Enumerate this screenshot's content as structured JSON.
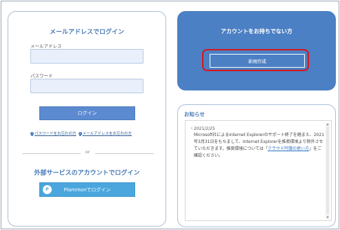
{
  "login": {
    "title": "メールアドレスでログイン",
    "email_label": "メールアドレス",
    "email_value": "",
    "password_label": "パスワード",
    "password_value": "",
    "login_button": "ログイン",
    "forgot_password": "パスワードをお忘れの方",
    "forgot_email": "メールアドレスをお忘れの方",
    "or_text": "or",
    "external_title": "外部サービスのアカウントでログイン",
    "external_button": "Plammonでログイン",
    "external_logo": "P"
  },
  "signup": {
    "title": "アカウントをお持ちでない方",
    "button": "新規作成"
  },
  "news": {
    "title": "お知らせ",
    "date": "・2021/2/25",
    "body_prefix": "Microsoft社によるInternet Explorerのサポート終了を踏まえ、2021年3月31日をもちまして、Internet Explorerを推奨環境より除外させていただきます。推奨環境については「",
    "link_text": "クラウド円簿の使い方",
    "body_suffix": "」をご確認ください。"
  },
  "colors": {
    "accent": "#4a7bb7",
    "signup_bg": "#4b80c4",
    "highlight": "#d7141a",
    "login_button": "#5b8ad0",
    "external_button": "#4aa6dd"
  },
  "icons": {
    "help": "question-circle-icon",
    "external_logo": "plammon-logo-icon",
    "scroll_up": "scroll-up-arrow-icon",
    "scroll_down": "scroll-down-arrow-icon"
  }
}
